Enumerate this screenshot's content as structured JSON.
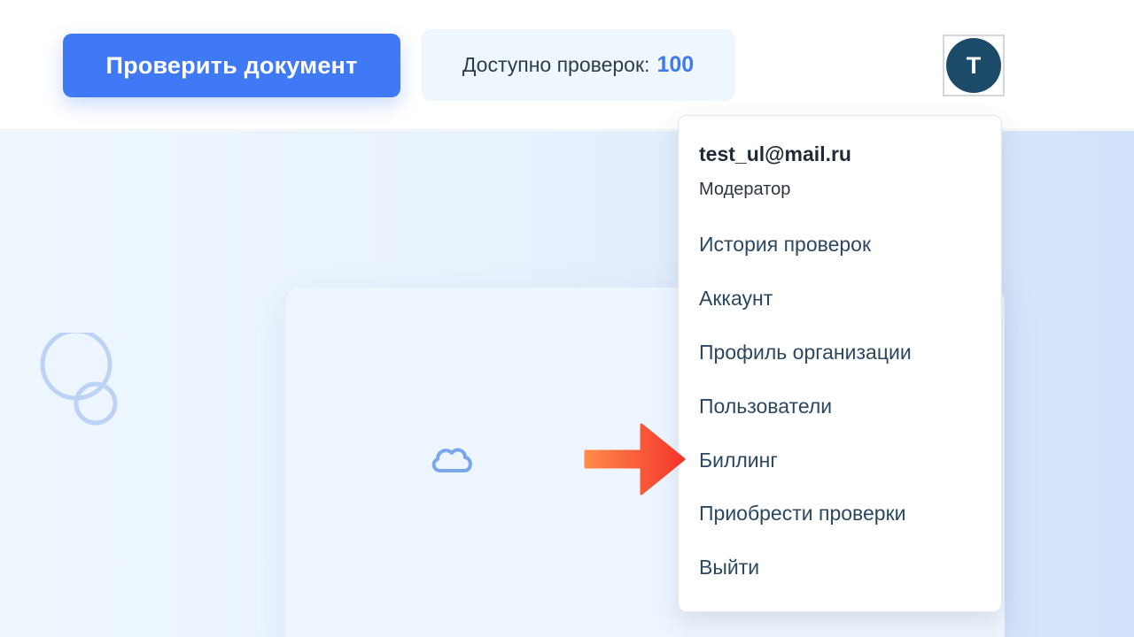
{
  "header": {
    "check_button_label": "Проверить документ",
    "checks_label": "Доступно проверок:",
    "checks_count": "100",
    "avatar_letter": "T"
  },
  "menu": {
    "email": "test_ul@mail.ru",
    "role": "Модератор",
    "items": [
      {
        "label": "История проверок"
      },
      {
        "label": "Аккаунт"
      },
      {
        "label": "Профиль организации"
      },
      {
        "label": "Пользователи"
      },
      {
        "label": "Биллинг"
      },
      {
        "label": "Приобрести проверки"
      },
      {
        "label": "Выйти"
      }
    ]
  },
  "colors": {
    "accent": "#3f79f6",
    "avatar_bg": "#1b4b69",
    "arrow": "#f4452e"
  },
  "icons": [
    "logo-mark-icon",
    "cloud-icon",
    "arrow-pointer-icon"
  ]
}
